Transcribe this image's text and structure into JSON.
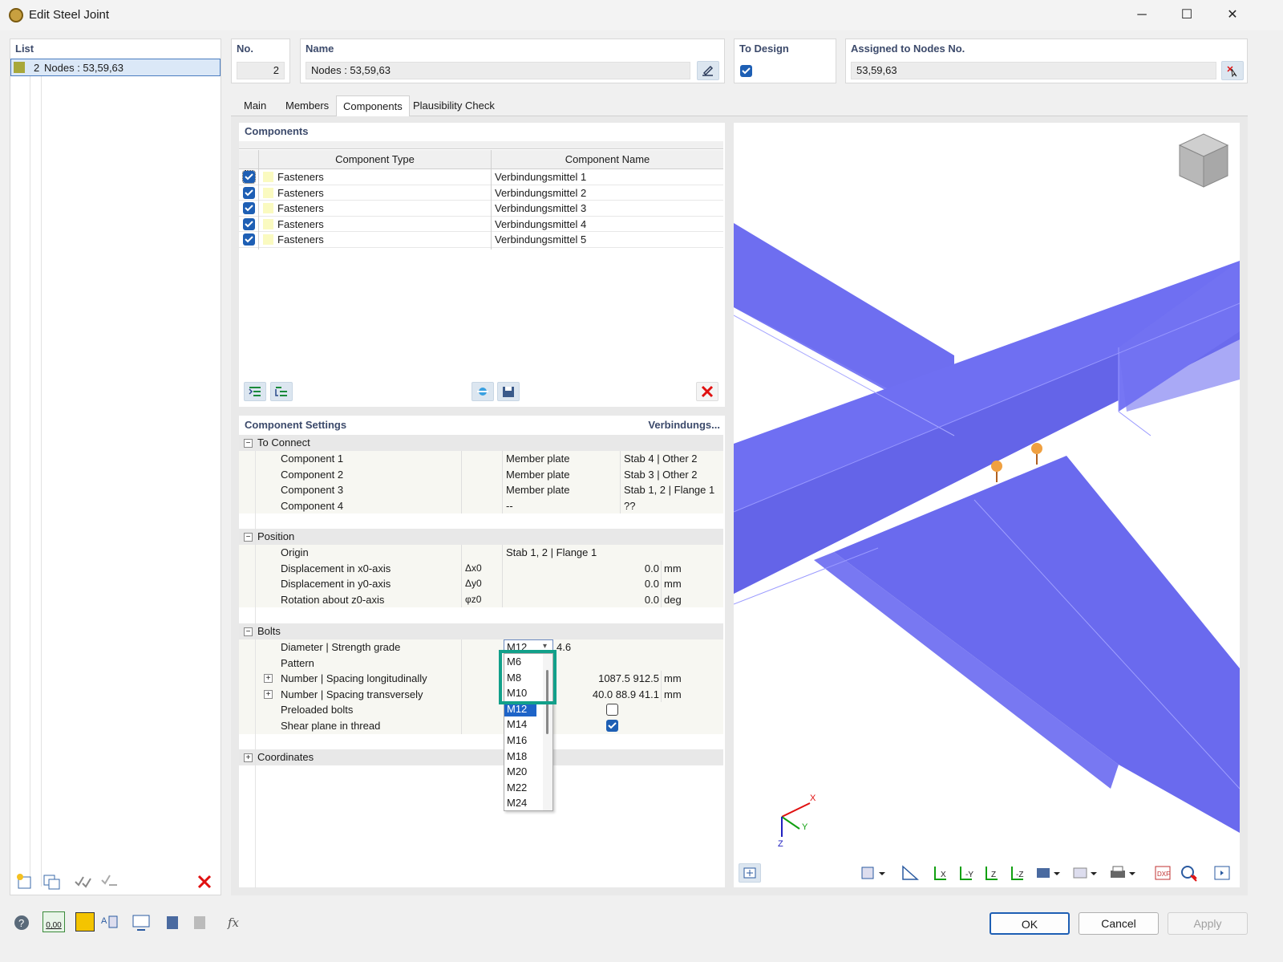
{
  "window": {
    "title": "Edit Steel Joint"
  },
  "list": {
    "header": "List",
    "items": [
      {
        "no": "2",
        "label": "Nodes : 53,59,63"
      }
    ]
  },
  "fields": {
    "no_label": "No.",
    "no_value": "2",
    "name_label": "Name",
    "name_value": "Nodes : 53,59,63",
    "to_design_label": "To Design",
    "assigned_label": "Assigned to Nodes No.",
    "assigned_value": "53,59,63"
  },
  "tabs": [
    "Main",
    "Members",
    "Components",
    "Plausibility Check"
  ],
  "components": {
    "header": "Components",
    "col_type": "Component Type",
    "col_name": "Component Name",
    "rows": [
      {
        "type": "Fasteners",
        "name": "Verbindungsmittel 1"
      },
      {
        "type": "Fasteners",
        "name": "Verbindungsmittel 2"
      },
      {
        "type": "Fasteners",
        "name": "Verbindungsmittel 3"
      },
      {
        "type": "Fasteners",
        "name": "Verbindungsmittel 4"
      },
      {
        "type": "Fasteners",
        "name": "Verbindungsmittel 5"
      }
    ]
  },
  "settings": {
    "header": "Component Settings",
    "header_right": "Verbindungs...",
    "to_connect": {
      "title": "To Connect",
      "rows": [
        {
          "label": "Component 1",
          "val": "Member plate",
          "ref": "Stab 4 | Other 2"
        },
        {
          "label": "Component 2",
          "val": "Member plate",
          "ref": "Stab 3 | Other 2"
        },
        {
          "label": "Component 3",
          "val": "Member plate",
          "ref": "Stab 1, 2 | Flange 1"
        },
        {
          "label": "Component 4",
          "val": "--",
          "ref": "??"
        }
      ]
    },
    "position": {
      "title": "Position",
      "origin_label": "Origin",
      "origin_val": "Stab 1, 2 | Flange 1",
      "rows": [
        {
          "label": "Displacement in x0-axis",
          "sym": "Δx0",
          "val": "0.0",
          "unit": "mm"
        },
        {
          "label": "Displacement in y0-axis",
          "sym": "Δy0",
          "val": "0.0",
          "unit": "mm"
        },
        {
          "label": "Rotation about z0-axis",
          "sym": "φz0",
          "val": "0.0",
          "unit": "deg"
        }
      ]
    },
    "bolts": {
      "title": "Bolts",
      "diameter_label": "Diameter | Strength grade",
      "diameter_val": "M12",
      "grade_val": "4.6",
      "pattern_label": "Pattern",
      "num_long_label": "Number | Spacing longitudinally",
      "num_long_val": "1087.5 912.5",
      "num_long_unit": "mm",
      "num_trans_label": "Number | Spacing transversely",
      "num_trans_val": "40.0 88.9 41.1",
      "num_trans_unit": "mm",
      "preloaded_label": "Preloaded bolts",
      "shear_label": "Shear plane in thread"
    },
    "coordinates": {
      "title": "Coordinates"
    }
  },
  "dropdown": {
    "options": [
      "M6",
      "M8",
      "M10",
      "M12",
      "M14",
      "M16",
      "M18",
      "M20",
      "M22",
      "M24"
    ],
    "selected": "M12"
  },
  "axes": {
    "x": "X",
    "y": "Y",
    "z": "Z"
  },
  "buttons": {
    "ok": "OK",
    "cancel": "Cancel",
    "apply": "Apply"
  },
  "bottom_value_icon": "0,00",
  "colors": {
    "beam": "#7070f0",
    "accent": "#1e5fb4",
    "highlight": "#12a08a"
  }
}
